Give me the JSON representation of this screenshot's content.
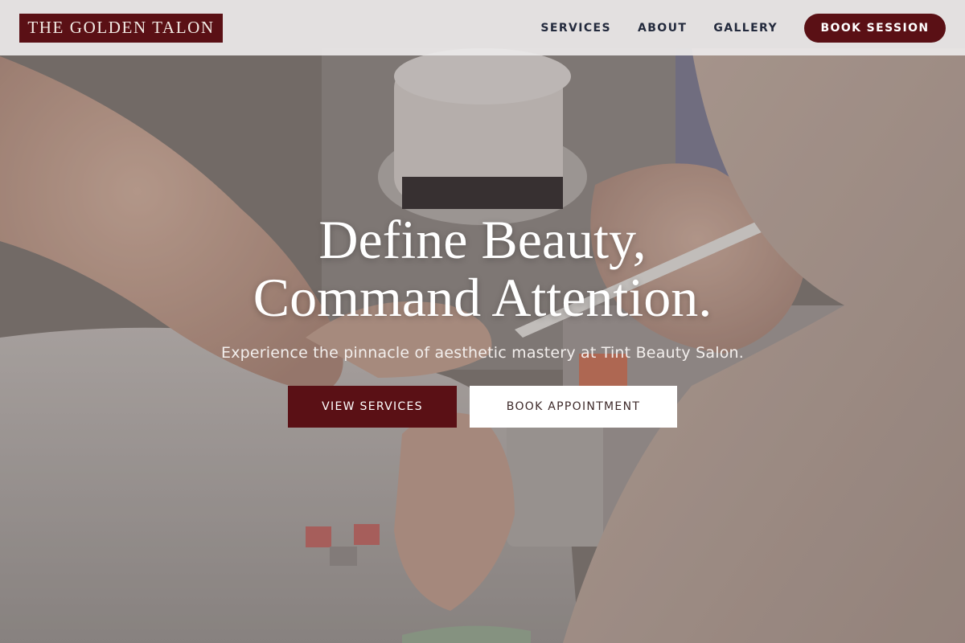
{
  "brand": {
    "logo_text": "THE GOLDEN TALON"
  },
  "nav": {
    "items": [
      {
        "label": "SERVICES"
      },
      {
        "label": "ABOUT"
      },
      {
        "label": "GALLERY"
      }
    ],
    "book_session_label": "BOOK SESSION"
  },
  "hero": {
    "title_line1": "Define Beauty,",
    "title_line2": "Command Attention.",
    "subtitle": "Experience the pinnacle of aesthetic mastery at Tint Beauty Salon.",
    "primary_cta": "VIEW SERVICES",
    "secondary_cta": "BOOK APPOINTMENT",
    "background_image": "manicure-photo"
  },
  "colors": {
    "brand_burgundy": "#5a1015",
    "nav_text": "#232a3d",
    "header_bg": "#eceae9",
    "white": "#ffffff"
  }
}
